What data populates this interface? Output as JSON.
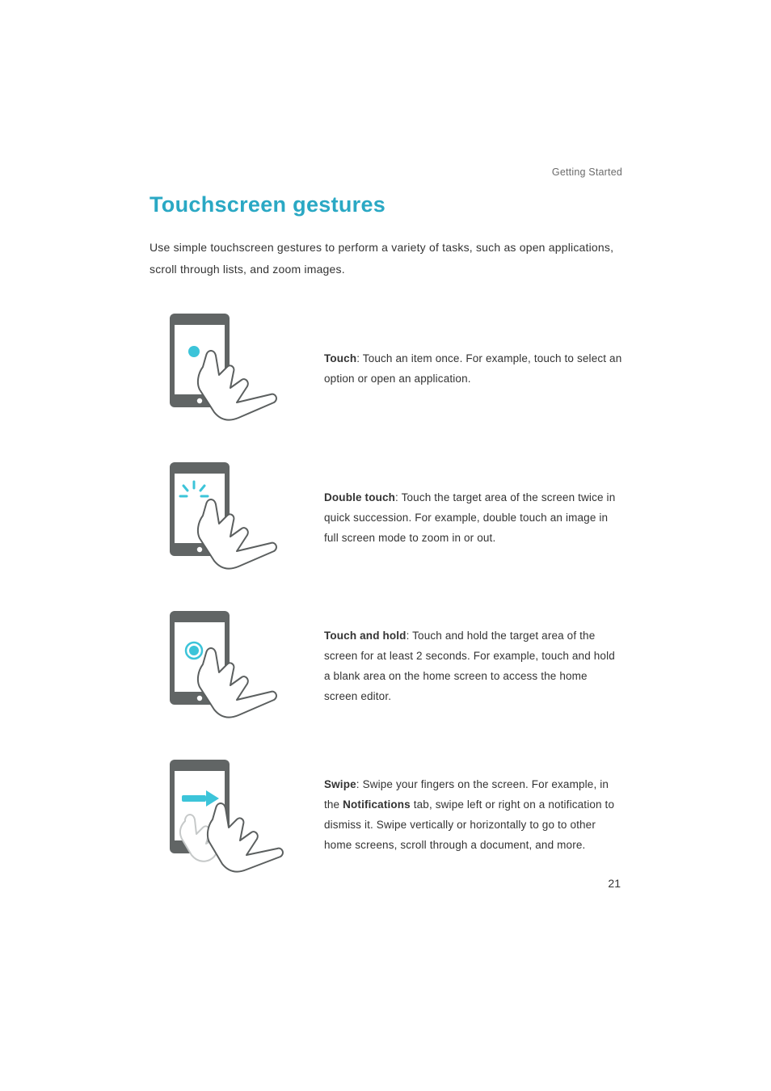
{
  "header": {
    "section_label": "Getting Started"
  },
  "page": {
    "title": "Touchscreen gestures",
    "intro": "Use simple touchscreen gestures to perform a variety of tasks, such as open applications, scroll through lists, and zoom images.",
    "gestures": [
      {
        "label": "Touch",
        "text": ": Touch an item once. For example, touch to select an option or open an application."
      },
      {
        "label": "Double touch",
        "text": ": Touch the target area of the screen twice in quick succession. For example, double touch an image in full screen mode to zoom in or out."
      },
      {
        "label": "Touch and hold",
        "text": ": Touch and hold the target area of the screen for at least 2 seconds. For example, touch and hold a blank area on the home screen to access the home screen editor."
      },
      {
        "label": "Swipe",
        "text_before": ": Swipe your fingers on the screen. For example, in the ",
        "strong": "Notifications",
        "text_after": " tab, swipe left or right on a notification to dismiss it. Swipe vertically or horizontally to go to other home screens, scroll through a document, and more."
      }
    ],
    "page_number": "21"
  },
  "colors": {
    "accent": "#2aa8c4"
  }
}
